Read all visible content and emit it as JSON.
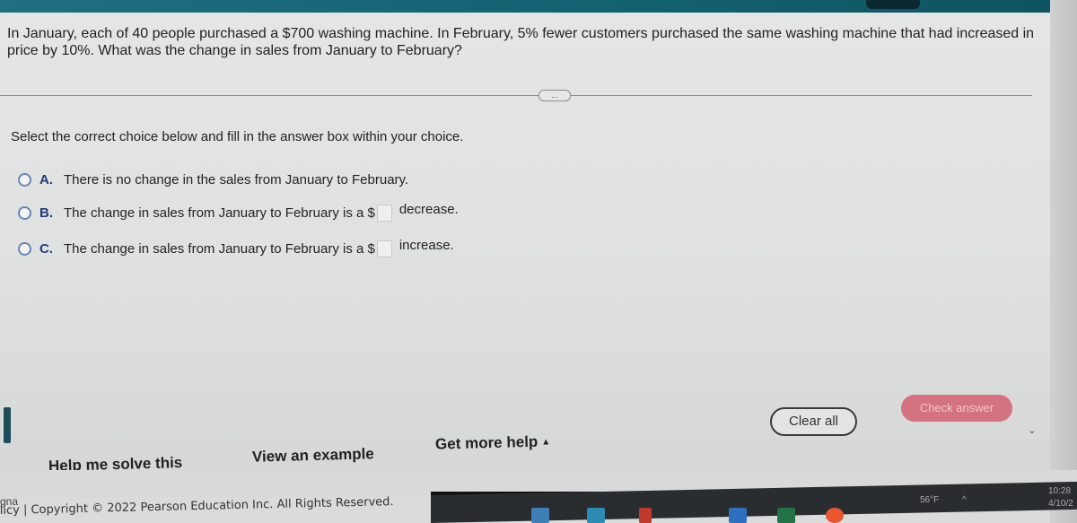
{
  "question": {
    "text": "In January, each of 40 people purchased a $700 washing machine. In February, 5% fewer customers purchased the same washing machine that had increased in price by 10%. What was the change in sales from January to February?"
  },
  "more_button": {
    "label": "..."
  },
  "instruction": "Select the correct choice below and fill in the answer box within your choice.",
  "choices": [
    {
      "letter": "A.",
      "text": "There is no change in the sales from January to February."
    },
    {
      "letter": "B.",
      "text": "The change in sales from January to February is a $",
      "answer_value": "",
      "suffix": "decrease."
    },
    {
      "letter": "C.",
      "text": "The change in sales from January to February is a $",
      "answer_value": "",
      "suffix": "increase."
    }
  ],
  "help_links": {
    "help_me_solve": "Help me solve this",
    "view_example": "View an example",
    "get_more_help": "Get more help",
    "get_more_help_caret": "▲"
  },
  "actions": {
    "clear_all": "Clear all",
    "check_answer": "Check answer"
  },
  "footer": {
    "side_text": "gna",
    "copyright": "licy | Copyright © 2022 Pearson Education Inc. All Rights Reserved."
  },
  "taskbar": {
    "weather": "56°F",
    "time": "10:28",
    "date": "4/10/2"
  },
  "colors": {
    "header_teal": "#13606f",
    "check_answer_bg": "#d4727f",
    "radio_border": "#6b84b8"
  }
}
